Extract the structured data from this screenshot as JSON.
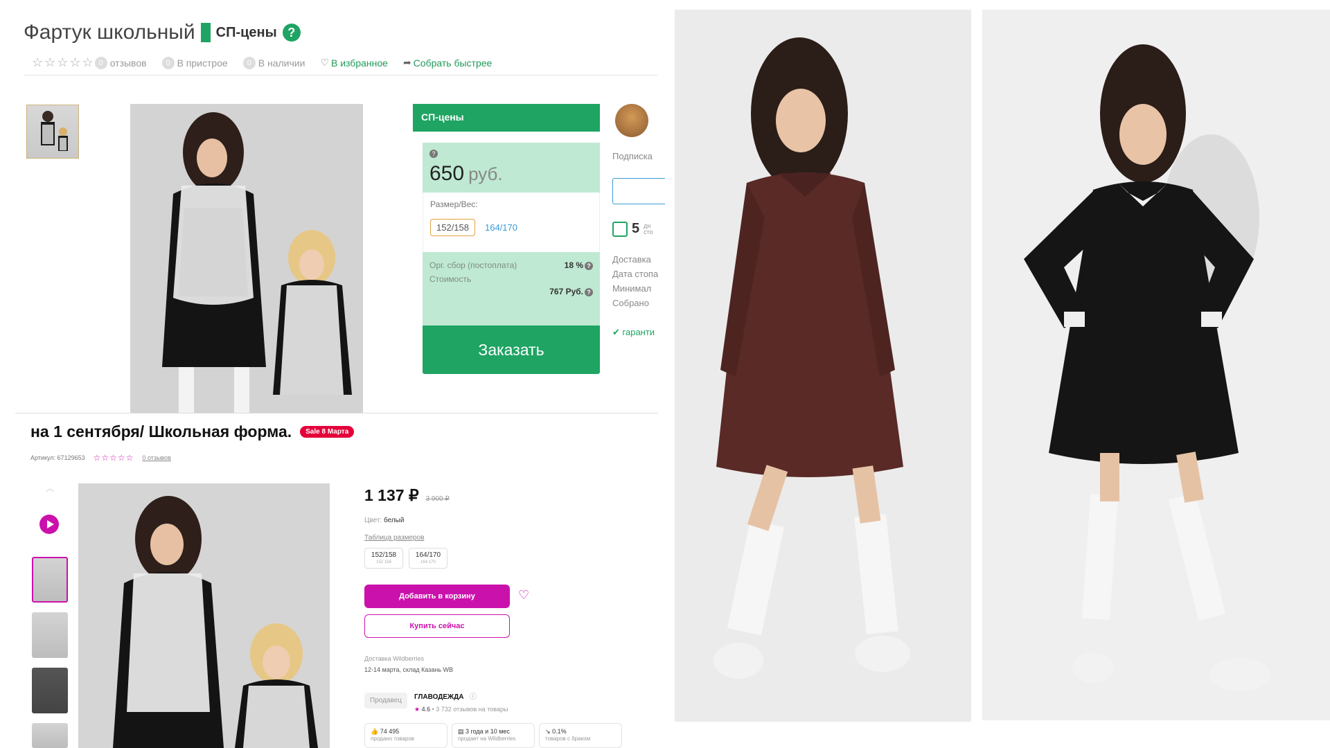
{
  "panelA": {
    "title": "Фартук школьный",
    "badge": "СП-цены",
    "help_icon": "question-circle-icon",
    "meta": {
      "reviews_count": "0",
      "reviews_label": "отзывов",
      "attached_count": "0",
      "attached_label": "В пристрое",
      "stock_count": "0",
      "stock_label": "В наличии",
      "favorite_label": "В избранное",
      "collect_label": "Собрать быстрее"
    },
    "price_box": {
      "header": "СП-цены",
      "price": "650",
      "currency": "руб.",
      "size_label": "Размер/Вес:",
      "sizes": [
        "152/158",
        "164/170"
      ],
      "org_fee_label": "Орг. сбор (постоплата)",
      "org_fee_value": "18 %",
      "cost_label": "Стоимость",
      "cost_value": "767 Руб.",
      "order_button": "Заказать"
    },
    "side": {
      "subscription": "Подписка",
      "days_num": "5",
      "days_small_1": "дн",
      "days_small_2": "сто",
      "lines": [
        "Доставка",
        "Дата стопа",
        "Минимал",
        "Собрано"
      ],
      "guarantee": "гаранти"
    }
  },
  "panelB": {
    "title": "на 1 сентября/ Школьная форма.",
    "sale_badge": "Sale 8 Марта",
    "article": "Артикул: 67129653",
    "reviews": "0 отзывов",
    "price": "1 137 ₽",
    "old_price": "3 900 ₽",
    "color_label": "Цвет:",
    "color_value": "белый",
    "size_table": "Таблица размеров",
    "sizes": [
      {
        "main": "152/158",
        "sub": "152 158"
      },
      {
        "main": "164/170",
        "sub": "164 170"
      }
    ],
    "add_to_cart": "Добавить в корзину",
    "buy_now": "Купить сейчас",
    "delivery_title": "Доставка Wildberries",
    "delivery_text": "12-14 марта, склад Казань WB",
    "seller_button": "Продавец",
    "seller_name": "ГЛАВОДЕЖДА",
    "seller_rating": "4.6",
    "seller_reviews": "3 732 отзывов на товары",
    "stats": [
      {
        "value": "74 495",
        "label": "продано товаров"
      },
      {
        "value": "3 года и 10 мес",
        "label": "продает на Wildberries"
      },
      {
        "value": "0.1%",
        "label": "товаров с браком"
      }
    ]
  },
  "colors": {
    "sp_green": "#1fa463",
    "sp_light_green": "#bfe9d2",
    "wb_purple": "#cb11ab",
    "brown_dress": "#5a2a26",
    "black_dress": "#151515"
  }
}
